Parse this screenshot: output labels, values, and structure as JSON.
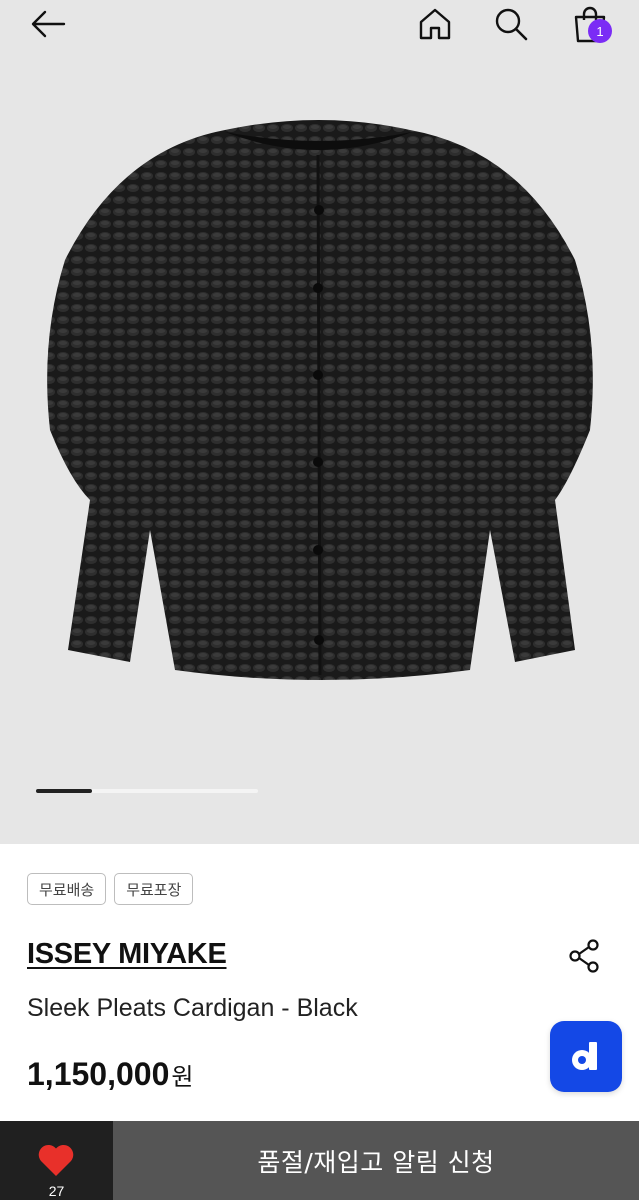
{
  "header": {
    "back_icon": "arrow-left-icon",
    "home_icon": "home-icon",
    "search_icon": "search-icon",
    "bag_icon": "shopping-bag-icon",
    "cart_count": "1",
    "badge_color": "#7b2cf5"
  },
  "gallery": {
    "image": "black pleated cardigan product photo",
    "background": "#e6e6e6",
    "progress": 0.25
  },
  "product": {
    "tags": [
      "무료배송",
      "무료포장"
    ],
    "brand": "ISSEY MIYAKE",
    "name": "Sleek Pleats Cardigan - Black",
    "price": "1,150,000",
    "currency": "원",
    "share_icon": "share-icon",
    "fab_icon": "d-logo-icon",
    "fab_color": "#1448e6"
  },
  "bottom_bar": {
    "like_icon": "heart-icon",
    "like_count": "27",
    "like_color": "#e8302a",
    "cta_label": "품절/재입고 알림 신청"
  }
}
